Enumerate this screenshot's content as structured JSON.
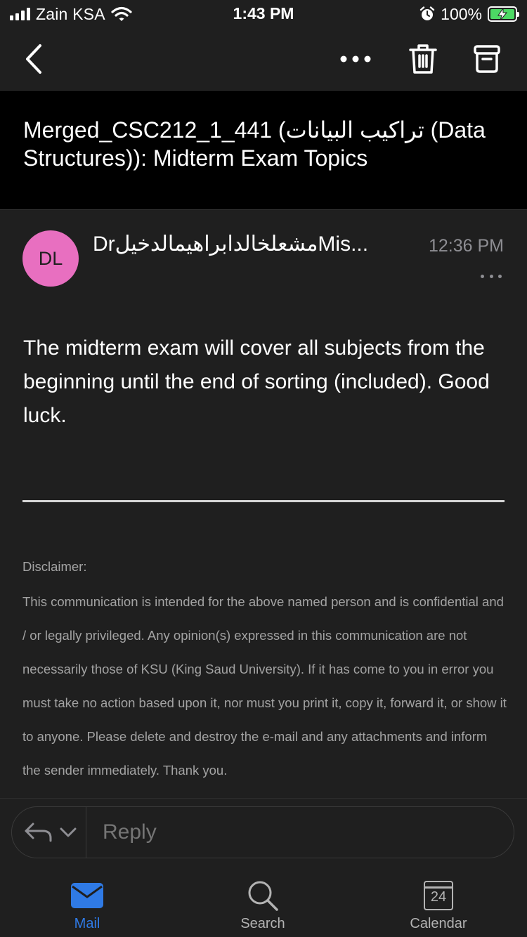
{
  "status_bar": {
    "carrier": "Zain KSA",
    "time": "1:43 PM",
    "battery_percent": "100%",
    "battery_level": 1.0,
    "icons": [
      "signal-icon",
      "wifi-icon",
      "alarm-icon",
      "battery-charging-icon"
    ]
  },
  "nav": {
    "icons": [
      "back-icon",
      "more-icon",
      "trash-icon",
      "archive-icon"
    ]
  },
  "email": {
    "subject": "Merged_CSC212_1_441 (تراكيب البيانات (Data Structures)): Midterm Exam Topics",
    "sender_initials": "DL",
    "sender_name": "DrمشعلخالدابراهيمالدخيلMis...",
    "received_time": "12:36 PM",
    "body": "The midterm exam will cover all subjects from the beginning until the end of sorting (included). Good luck.",
    "disclaimer_title": "Disclaimer:",
    "disclaimer_body": "This communication is intended for the above named person and is confidential and / or legally privileged. Any opinion(s) expressed in this communication are not necessarily those of KSU (King Saud University). If it has come to you in error you must take no action based upon it, nor must you print it, copy it, forward it, or show it to anyone. Please delete and destroy the e-mail and any attachments and inform the sender immediately. Thank you."
  },
  "reply": {
    "placeholder": "Reply",
    "icons": [
      "reply-icon",
      "chevron-down-icon"
    ]
  },
  "tabs": [
    {
      "label": "Mail",
      "icon": "mail-icon",
      "active": true
    },
    {
      "label": "Search",
      "icon": "search-icon",
      "active": false
    },
    {
      "label": "Calendar",
      "icon": "calendar-icon",
      "active": false,
      "day": "24"
    }
  ],
  "colors": {
    "background": "#1f1f1f",
    "subject_background": "#000000",
    "avatar": "#e86fc0",
    "accent": "#2f7ae5",
    "battery": "#4cd964",
    "secondary_text": "#8e8e93"
  }
}
